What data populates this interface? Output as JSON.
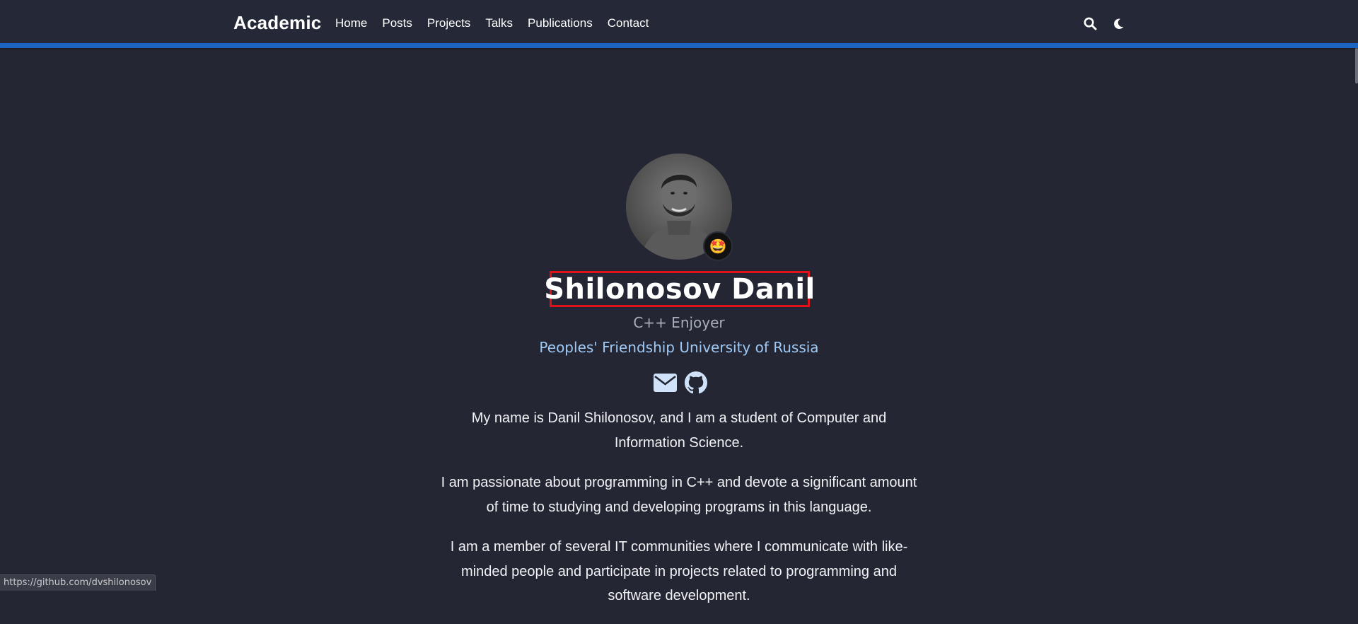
{
  "navbar": {
    "brand": "Academic",
    "links": [
      "Home",
      "Posts",
      "Projects",
      "Talks",
      "Publications",
      "Contact"
    ]
  },
  "icons": {
    "search": "search-icon",
    "theme": "moon-icon",
    "email": "envelope-icon",
    "github": "github-icon",
    "status_emoji": "🤩"
  },
  "profile": {
    "name": "Shilonosov Danil",
    "role": "C++ Enjoyer",
    "organization": "Peoples' Friendship University of Russia"
  },
  "bio": {
    "paragraphs": [
      "My name is Danil Shilonosov, and I am a student of Computer and Information Science.",
      "I am passionate about programming in C++ and devote a significant amount of time to studying and developing programs in this language.",
      "I am a member of several IT communities where I communicate with like-minded people and participate in projects related to programming and software development."
    ]
  },
  "status_bar": {
    "url": "https://github.com/dvshilonosov"
  },
  "colors": {
    "background": "#242733",
    "accent": "#1b65c1",
    "link": "#9fc9f5",
    "highlight_border": "#e0111b"
  }
}
